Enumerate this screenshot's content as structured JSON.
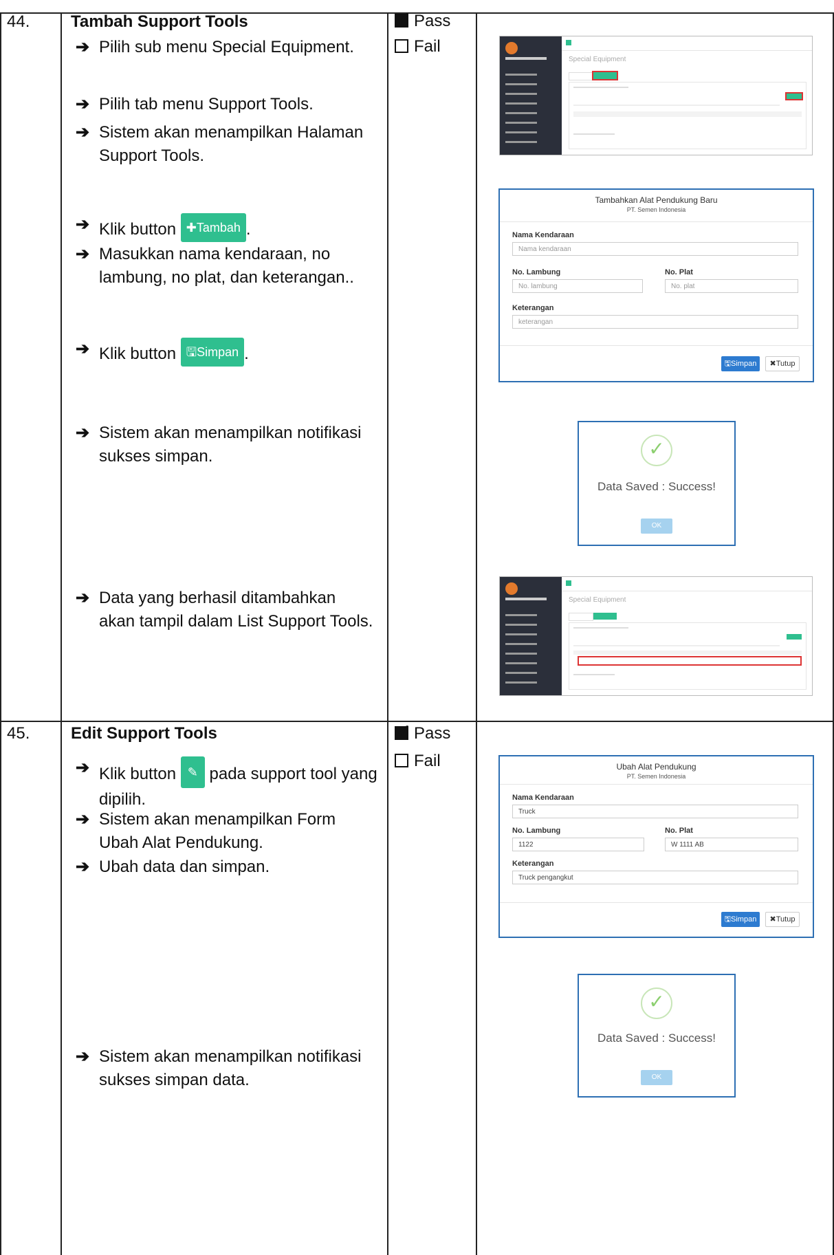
{
  "rows": [
    {
      "number": "44.",
      "title": "Tambah Support Tools",
      "steps": [
        "Pilih sub menu Special Equipment.",
        "Pilih tab menu Support Tools.",
        "Sistem akan menampilkan Halaman Support Tools.",
        "Klik button",
        "Masukkan nama kendaraan, no lambung, no plat, dan keterangan..",
        "Klik button",
        "Sistem akan menampilkan notifikasi sukses simpan.",
        "Data yang berhasil ditambahkan akan tampil dalam List Support Tools."
      ],
      "tambah_button": "Tambah",
      "simpan_button": "Simpan",
      "pass_label": "Pass",
      "fail_label": "Fail",
      "screen_title": "Special Equipment",
      "add_dialog": {
        "title": "Tambahkan Alat Pendukung Baru",
        "subtitle": "PT. Semen Indonesia",
        "nama_label": "Nama Kendaraan",
        "nama_placeholder": "Nama kendaraan",
        "lambung_label": "No. Lambung",
        "lambung_placeholder": "No. lambung",
        "plat_label": "No. Plat",
        "plat_placeholder": "No. plat",
        "ket_label": "Keterangan",
        "ket_placeholder": "keterangan",
        "save": "Simpan",
        "close": "Tutup"
      },
      "notification": {
        "message": "Data Saved : Success!",
        "ok": "OK"
      }
    },
    {
      "number": "45.",
      "title": "Edit Support Tools",
      "steps": [
        "Klik button",
        "pada support tool yang dipilih.",
        "Sistem akan menampilkan Form Ubah Alat Pendukung.",
        "Ubah data dan simpan.",
        "Sistem akan menampilkan notifikasi sukses simpan data."
      ],
      "pass_label": "Pass",
      "fail_label": "Fail",
      "edit_dialog": {
        "title": "Ubah Alat Pendukung",
        "subtitle": "PT. Semen Indonesia",
        "nama_label": "Nama Kendaraan",
        "nama_value": "Truck",
        "lambung_label": "No. Lambung",
        "lambung_value": "1122",
        "plat_label": "No. Plat",
        "plat_value": "W 1111 AB",
        "ket_label": "Keterangan",
        "ket_value": "Truck pengangkut",
        "save": "Simpan",
        "close": "Tutup"
      },
      "notification": {
        "message": "Data Saved : Success!",
        "ok": "OK"
      }
    }
  ]
}
